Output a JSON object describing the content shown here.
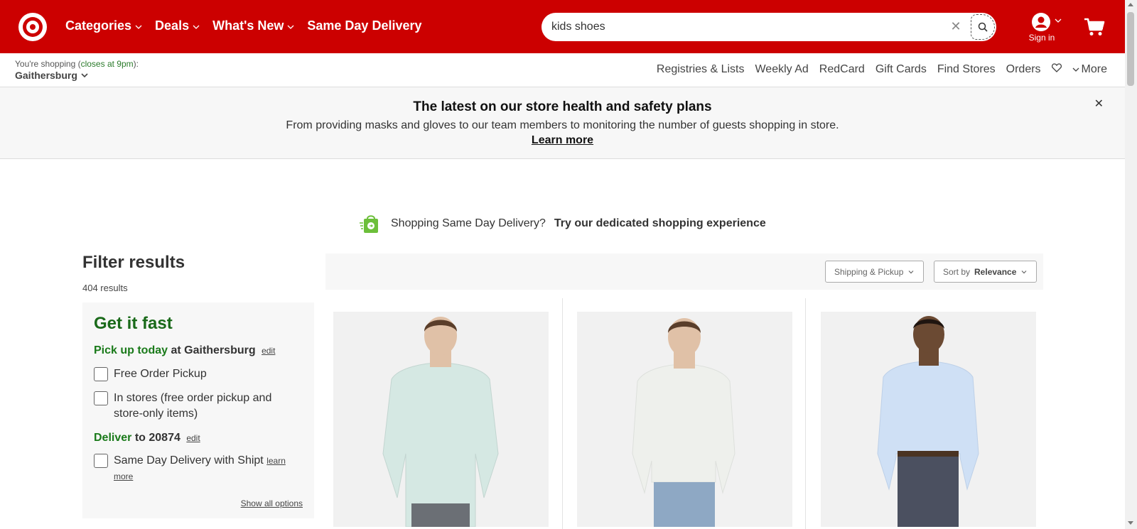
{
  "colors": {
    "brand_red": "#cc0000",
    "green": "#1a7a1a"
  },
  "header": {
    "logo": "target-logo",
    "nav": [
      "Categories",
      "Deals",
      "What's New",
      "Same Day Delivery"
    ],
    "search_value": "kids shoes",
    "sign_in": "Sign in"
  },
  "store": {
    "prefix": "You're shopping (",
    "closes": "closes at 9pm",
    "suffix": "):",
    "name": "Gaithersburg"
  },
  "utility_nav": [
    "Registries & Lists",
    "Weekly Ad",
    "RedCard",
    "Gift Cards",
    "Find Stores",
    "Orders"
  ],
  "utility_more": "More",
  "banner": {
    "title": "The latest on our store health and safety plans",
    "text": "From providing masks and gloves to our team members to monitoring the number of guests shopping in store.",
    "link": "Learn more"
  },
  "sdd_promo": {
    "question": "Shopping Same Day Delivery?",
    "cta": "Try our dedicated shopping experience"
  },
  "filter": {
    "title": "Filter results",
    "results": "404 results",
    "get_it_fast": "Get it fast",
    "pickup_green": "Pick up today",
    "pickup_at": " at Gaithersburg",
    "edit": "edit",
    "option_free_pickup": "Free Order Pickup",
    "option_in_stores_1": "In stores (free order pickup and",
    "option_in_stores_2": "store-only items)",
    "deliver_green": "Deliver",
    "deliver_to": " to 20874",
    "option_sdd": "Same Day Delivery with Shipt",
    "learn_1": "learn",
    "learn_2": "more",
    "show_all": "Show all options"
  },
  "sort": {
    "shipping": "Shipping & Pickup",
    "sort_prefix": "Sort by",
    "sort_value": "Relevance"
  },
  "products": [
    {
      "shirt": "#d5e8e3",
      "pants": "#6b6f75"
    },
    {
      "shirt": "#eef0ec",
      "pants": "#8ea8c4"
    },
    {
      "shirt": "#cfe0f5",
      "pants": "#4b5060"
    }
  ]
}
